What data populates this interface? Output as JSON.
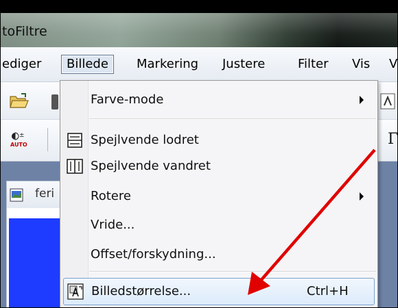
{
  "window": {
    "title": "toFiltre"
  },
  "menubar": {
    "items": [
      "ediger",
      "Billede",
      "Markering",
      "Justere",
      "Filter",
      "Vis",
      "V"
    ]
  },
  "document": {
    "tab_label": "feri"
  },
  "dropdown": {
    "items": [
      {
        "label": "Farve-mode",
        "submenu": true
      },
      {
        "label": "Spejlvende lodret",
        "icon": "flip-vertical-icon"
      },
      {
        "label": "Spejlvende vandret",
        "icon": "flip-horizontal-icon"
      },
      {
        "label": "Rotere",
        "submenu": true
      },
      {
        "label": "Vride..."
      },
      {
        "label": "Offset/forskydning..."
      },
      {
        "label": "Billedstørrelse...",
        "shortcut": "Ctrl+H",
        "icon": "image-size-icon",
        "highlighted": true
      }
    ]
  },
  "toolbar": {
    "auto_label": "AUTO",
    "gamma_glyph": "Γ"
  },
  "colors": {
    "annotation_arrow": "#e00000",
    "highlight_border": "#7da2ce",
    "canvas": "#1e3cff"
  }
}
